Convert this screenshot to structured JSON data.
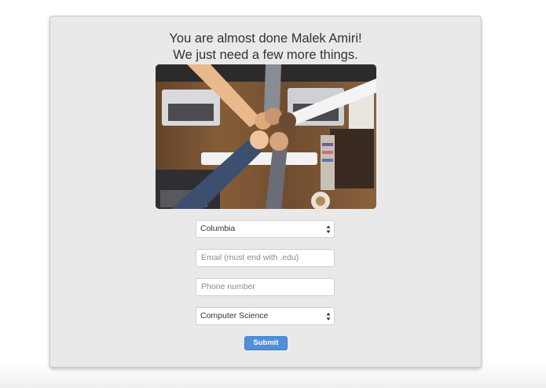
{
  "header": {
    "line1": "You are almost done Malek Amiri!",
    "line2": "We just need a few more things."
  },
  "form": {
    "university_value": "Columbia",
    "email_placeholder": "Email (must end with .edu)",
    "phone_placeholder": "Phone number",
    "major_value": "Computer Science",
    "submit_label": "Submit"
  },
  "colors": {
    "card_background": "#e9e9e9",
    "submit_button": "#4f8fdc"
  }
}
